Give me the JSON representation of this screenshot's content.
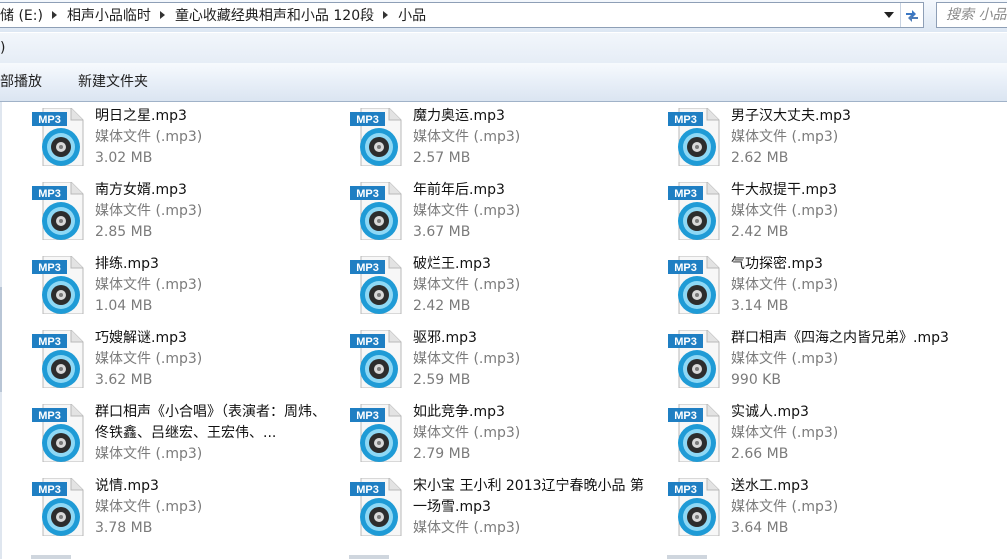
{
  "address_bar": {
    "breadcrumbs": [
      "储 (E:)",
      "相声小品临时",
      "童心收藏经典相声和小品 120段",
      "小品"
    ],
    "search_placeholder": "搜索 小品"
  },
  "menu": {
    "partial_item": ")"
  },
  "toolbar": {
    "play_all": "部播放",
    "new_folder": "新建文件夹"
  },
  "colors": {
    "toolbar_border": "#a0b2c8",
    "meta_text": "#7b7b7b",
    "icon_blue": "#1f9bd6"
  },
  "files": [
    [
      {
        "name": "明日之星.mp3",
        "type": "媒体文件 (.mp3)",
        "size": "3.02 MB"
      },
      {
        "name": "南方女婿.mp3",
        "type": "媒体文件 (.mp3)",
        "size": "2.85 MB"
      },
      {
        "name": "排练.mp3",
        "type": "媒体文件 (.mp3)",
        "size": "1.04 MB"
      },
      {
        "name": "巧嫂解谜.mp3",
        "type": "媒体文件 (.mp3)",
        "size": "3.62 MB"
      },
      {
        "name": "群口相声《小合唱》（表演者：周炜、佟铁鑫、吕继宏、王宏伟、...",
        "type": "媒体文件 (.mp3)",
        "size": ""
      },
      {
        "name": "说情.mp3",
        "type": "媒体文件 (.mp3)",
        "size": "3.78 MB"
      }
    ],
    [
      {
        "name": "魔力奥运.mp3",
        "type": "媒体文件 (.mp3)",
        "size": "2.57 MB"
      },
      {
        "name": "年前年后.mp3",
        "type": "媒体文件 (.mp3)",
        "size": "3.67 MB"
      },
      {
        "name": "破烂王.mp3",
        "type": "媒体文件 (.mp3)",
        "size": "2.42 MB"
      },
      {
        "name": "驱邪.mp3",
        "type": "媒体文件 (.mp3)",
        "size": "2.59 MB"
      },
      {
        "name": "如此竞争.mp3",
        "type": "媒体文件 (.mp3)",
        "size": "2.79 MB"
      },
      {
        "name": "宋小宝 王小利 2013辽宁春晚小品 第一场雪.mp3",
        "type": "媒体文件 (.mp3)",
        "size": ""
      }
    ],
    [
      {
        "name": "男子汉大丈夫.mp3",
        "type": "媒体文件 (.mp3)",
        "size": "2.62 MB"
      },
      {
        "name": "牛大叔提干.mp3",
        "type": "媒体文件 (.mp3)",
        "size": "2.42 MB"
      },
      {
        "name": "气功探密.mp3",
        "type": "媒体文件 (.mp3)",
        "size": "3.14 MB"
      },
      {
        "name": "群口相声《四海之内皆兄弟》.mp3",
        "type": "媒体文件 (.mp3)",
        "size": "990 KB"
      },
      {
        "name": "实诚人.mp3",
        "type": "媒体文件 (.mp3)",
        "size": "2.66 MB"
      },
      {
        "name": "送水工.mp3",
        "type": "媒体文件 (.mp3)",
        "size": "3.64 MB"
      }
    ]
  ],
  "icon": {
    "label": "MP3",
    "name": "mp3-file-icon"
  }
}
